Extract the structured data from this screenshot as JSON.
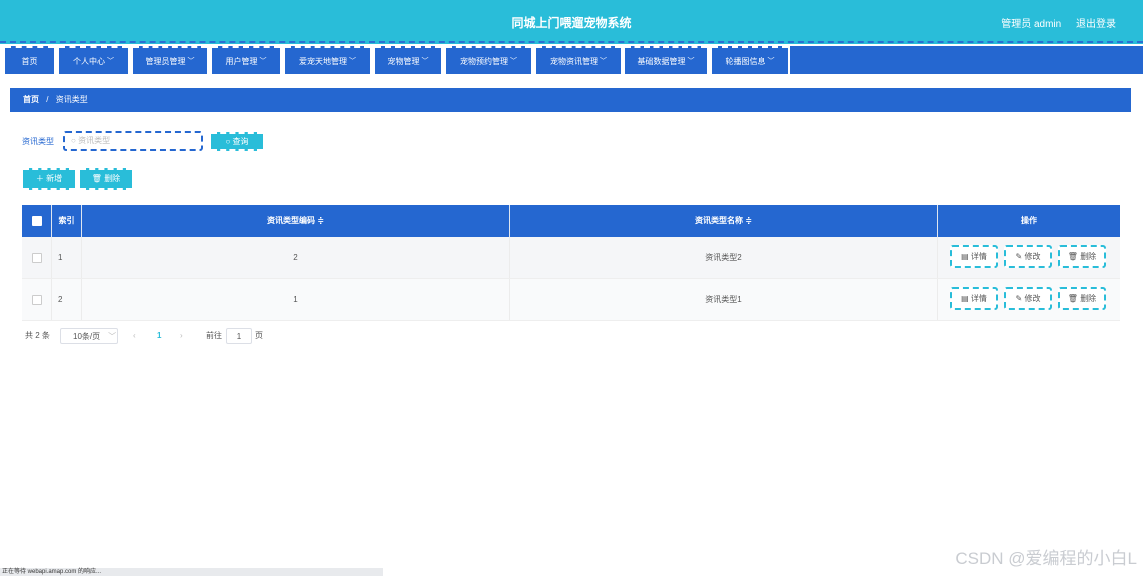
{
  "header": {
    "title": "同城上门喂遛宠物系统",
    "user": "管理员 admin",
    "logout": "退出登录"
  },
  "nav": [
    {
      "label": "首页",
      "chev": false
    },
    {
      "label": "个人中心",
      "chev": true
    },
    {
      "label": "管理员管理",
      "chev": true
    },
    {
      "label": "用户管理",
      "chev": true
    },
    {
      "label": "爱宠天地管理",
      "chev": true
    },
    {
      "label": "宠物管理",
      "chev": true
    },
    {
      "label": "宠物预约管理",
      "chev": true
    },
    {
      "label": "宠物资讯管理",
      "chev": true
    },
    {
      "label": "基础数据管理",
      "chev": true
    },
    {
      "label": "轮播图信息",
      "chev": true
    }
  ],
  "breadcrumb": {
    "home": "首页",
    "sep": "/",
    "current": "资讯类型"
  },
  "search": {
    "label": "资讯类型",
    "placeholder": "资讯类型",
    "button": "查询"
  },
  "actions": {
    "add": "新增",
    "delete": "删除"
  },
  "table": {
    "headers": [
      "索引",
      "资讯类型编码 ≑",
      "资讯类型名称 ≑",
      "操作"
    ],
    "rows": [
      {
        "index": "1",
        "code": "2",
        "name": "资讯类型2"
      },
      {
        "index": "2",
        "code": "1",
        "name": "资讯类型1"
      }
    ],
    "ops": {
      "detail": "详情",
      "edit": "修改",
      "delete": "删除"
    }
  },
  "pagination": {
    "total": "共 2 条",
    "page_size": "10条/页",
    "current": "1",
    "goto_prefix": "前往",
    "goto_value": "1",
    "goto_suffix": "页"
  },
  "status_bar": "正在等待 webapi.amap.com 的响应...",
  "watermark": "CSDN @爱编程的小白L",
  "colors": {
    "header": "#29bdd9",
    "nav": "#2567d0",
    "accent": "#29bdd9"
  }
}
